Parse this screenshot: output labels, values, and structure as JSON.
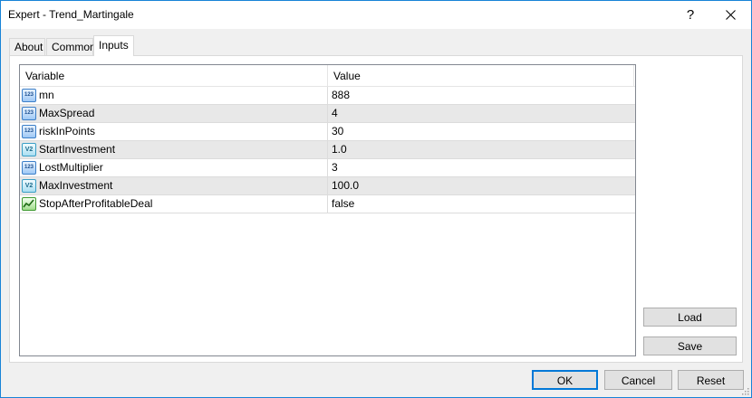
{
  "window": {
    "title": "Expert - Trend_Martingale",
    "help_label": "?",
    "close_icon": "close-icon"
  },
  "tabs": [
    {
      "label": "About"
    },
    {
      "label": "Common"
    },
    {
      "label": "Inputs",
      "active": true
    }
  ],
  "grid": {
    "columns": {
      "variable": "Variable",
      "value": "Value"
    },
    "rows": [
      {
        "icon": "integer-icon",
        "icon_text": "123",
        "variable": "mn",
        "value": "888"
      },
      {
        "icon": "integer-icon",
        "icon_text": "123",
        "variable": "MaxSpread",
        "value": "4"
      },
      {
        "icon": "integer-icon",
        "icon_text": "123",
        "variable": "riskInPoints",
        "value": "30"
      },
      {
        "icon": "double-icon",
        "icon_text": "V2",
        "variable": "StartInvestment",
        "value": "1.0"
      },
      {
        "icon": "integer-icon",
        "icon_text": "123",
        "variable": "LostMultiplier",
        "value": "3"
      },
      {
        "icon": "double-icon",
        "icon_text": "V2",
        "variable": "MaxInvestment",
        "value": "100.0"
      },
      {
        "icon": "boolean-icon",
        "icon_text": "",
        "variable": "StopAfterProfitableDeal",
        "value": "false"
      }
    ]
  },
  "side_buttons": {
    "load_label": "Load",
    "save_label": "Save"
  },
  "footer_buttons": {
    "ok_label": "OK",
    "cancel_label": "Cancel",
    "reset_label": "Reset"
  }
}
